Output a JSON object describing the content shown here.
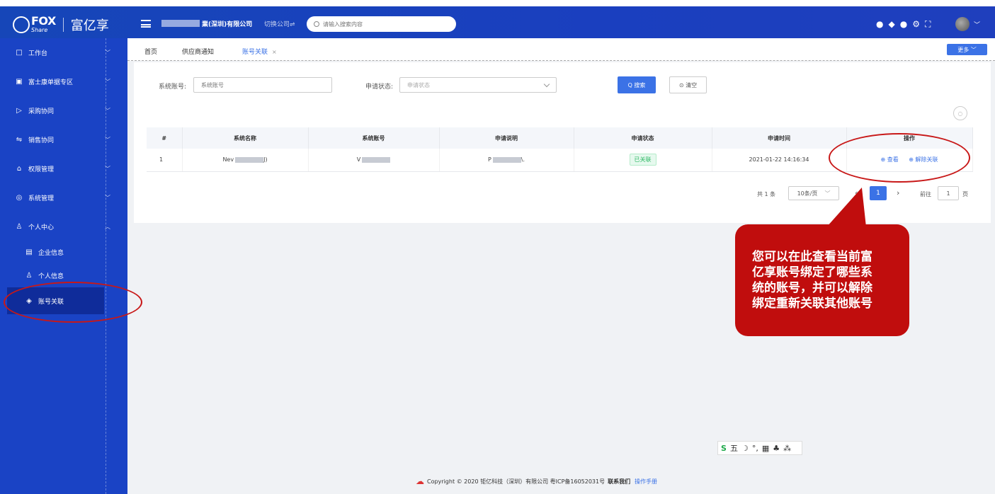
{
  "header": {
    "logo_main": "FOX",
    "logo_sub": "Share",
    "brand": "富亿享",
    "company_name": "業(深圳)有限公司",
    "switch_company": "切换公司⇌",
    "search_placeholder": "请输入搜索内容",
    "icons": [
      "message-icon",
      "location-icon",
      "lock-icon",
      "settings-icon",
      "fullscreen-icon"
    ],
    "icon_glyphs": [
      "●",
      "◆",
      "●",
      "⚙",
      "⛶"
    ]
  },
  "sidebar": {
    "items": [
      {
        "label": "工作台",
        "icon": "□"
      },
      {
        "label": "富士康单据专区",
        "icon": "▣"
      },
      {
        "label": "采购协同",
        "icon": "▷"
      },
      {
        "label": "销售协同",
        "icon": "⇋"
      },
      {
        "label": "权限管理",
        "icon": "⌂"
      },
      {
        "label": "系统管理",
        "icon": "◎"
      },
      {
        "label": "个人中心",
        "icon": "♙"
      },
      {
        "label": "企业信息",
        "icon": "▤"
      },
      {
        "label": "个人信息",
        "icon": "♙"
      },
      {
        "label": "账号关联",
        "icon": "◈"
      }
    ]
  },
  "tabs": {
    "items": [
      "首页",
      "供应商通知",
      "账号关联"
    ],
    "close": "×",
    "more": "更多 ﹀"
  },
  "filter": {
    "account_label": "系统账号:",
    "account_placeholder": "系统账号",
    "status_label": "申请状态:",
    "status_placeholder": "申请状态",
    "search_btn": "Q 搜索",
    "clear_btn": "⊙ 清空"
  },
  "table": {
    "headers": [
      "#",
      "系统名称",
      "系统账号",
      "申请说明",
      "申请状态",
      "申请时间",
      "操作"
    ],
    "rows": [
      {
        "index": "1",
        "name": "Nev",
        "name_tail": "J)",
        "account": "V",
        "desc": "P",
        "desc_tail": "\\.",
        "status": "已关联",
        "time": "2021-01-22 14:16:34",
        "view": "⊕ 查看",
        "unlink": "⊕ 解除关联"
      }
    ]
  },
  "pager": {
    "total": "共 1 条",
    "page_size": "10条/页",
    "prev": "‹",
    "current": "1",
    "next": "›",
    "goto_label": "前往",
    "goto_value": "1",
    "page_unit": "页"
  },
  "callout": {
    "lines": [
      "您可以在此查看当前富",
      "亿享账号绑定了哪些系",
      "统的账号，并可以解除",
      "绑定重新关联其他账号"
    ]
  },
  "ime": {
    "items": [
      "S",
      "五",
      "☽",
      "°,",
      "▦",
      "♣",
      "⁂"
    ]
  },
  "footer": {
    "copyright": "Copyright © 2020 钜亿科技（深圳）有限公司 粤ICP备16052031号",
    "contact": "联系我们",
    "manual": "操作手册"
  }
}
